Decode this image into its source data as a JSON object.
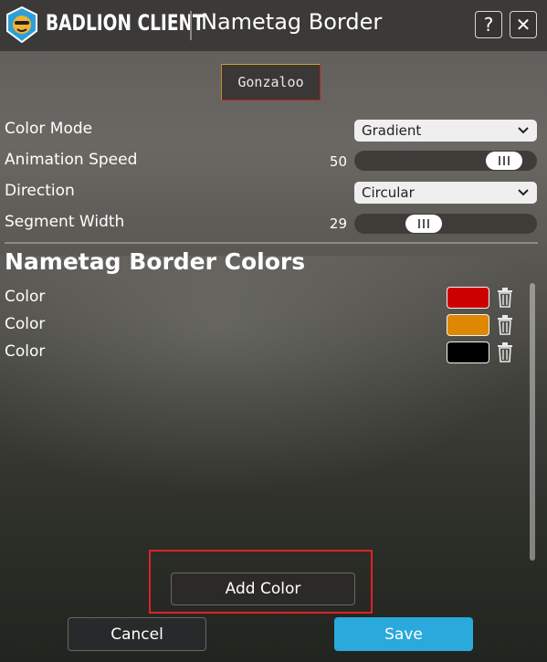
{
  "header": {
    "brand": "BADLION CLIENT",
    "title": "Nametag Border",
    "help_label": "?",
    "close_label": "✕"
  },
  "preview": {
    "name": "Gonzaloo"
  },
  "settings": {
    "color_mode": {
      "label": "Color Mode",
      "value": "Gradient"
    },
    "animation_speed": {
      "label": "Animation Speed",
      "value": "50",
      "fraction": 0.9
    },
    "direction": {
      "label": "Direction",
      "value": "Circular"
    },
    "segment_width": {
      "label": "Segment Width",
      "value": "29",
      "fraction": 0.35
    }
  },
  "colors_section": {
    "title": "Nametag Border Colors",
    "items": [
      {
        "label": "Color",
        "color": "#cc0000"
      },
      {
        "label": "Color",
        "color": "#dd8800"
      },
      {
        "label": "Color",
        "color": "#000000"
      }
    ]
  },
  "buttons": {
    "add_color": "Add Color",
    "cancel": "Cancel",
    "save": "Save"
  },
  "theme": {
    "accent": "#2aa9dc",
    "highlight": "#e0202a"
  }
}
